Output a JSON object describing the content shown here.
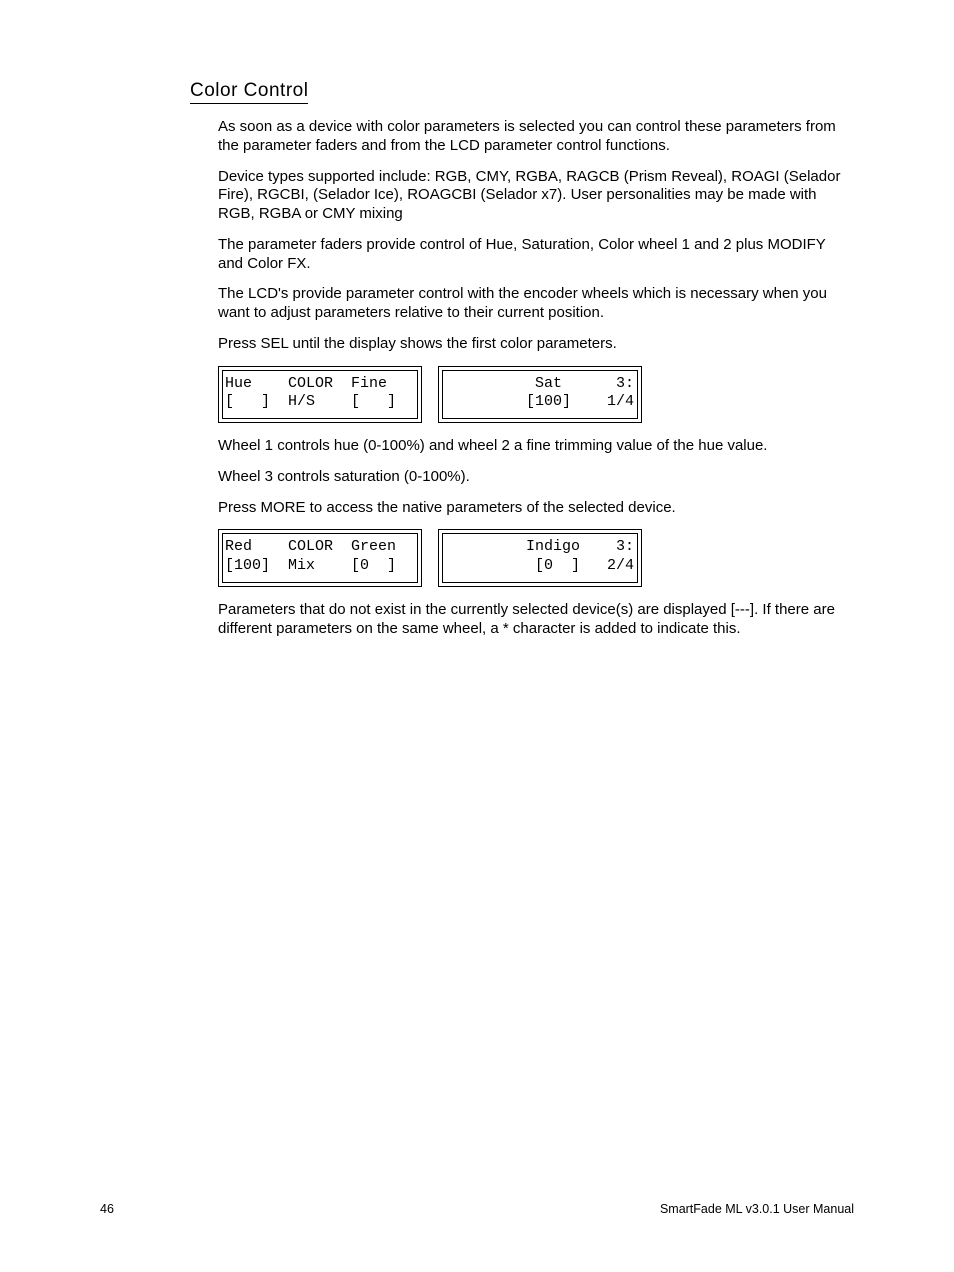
{
  "section_title": "Color Control",
  "paragraphs_a": [
    "As soon as a device with color parameters is selected you can control these parameters from the parameter faders and from the LCD parameter control functions.",
    "Device types supported include:  RGB, CMY, RGBA, RAGCB (Prism Reveal), ROAGI (Selador Fire), RGCBI, (Selador Ice), ROAGCBI (Selador x7). User personalities may be made with RGB, RGBA or CMY mixing",
    "The parameter faders provide control of Hue, Saturation, Color wheel 1 and 2 plus MODIFY and Color FX.",
    "The LCD's provide parameter control with the encoder wheels which is necessary when you want to adjust parameters relative to their current position.",
    "Press SEL until the display shows the first color parameters."
  ],
  "lcd1": {
    "left": "Hue    COLOR  Fine\n[   ]  H/S    [   ]",
    "right": "          Sat      3:\n         [100]    1/4"
  },
  "paragraphs_b": [
    "Wheel 1 controls hue (0-100%) and wheel 2 a fine trimming value of the hue value.",
    "Wheel 3 controls saturation (0-100%).",
    "Press MORE to access the native parameters of the selected device."
  ],
  "lcd2": {
    "left": "Red    COLOR  Green\n[100]  Mix    [0  ]",
    "right": "         Indigo    3:\n          [0  ]   2/4"
  },
  "paragraphs_c": [
    "Parameters that do not exist in the currently selected device(s) are displayed [---]. If there are different parameters on the same wheel, a * character is added to indicate this."
  ],
  "footer": {
    "page_number": "46",
    "manual_title": "SmartFade ML v3.0.1 User Manual"
  }
}
